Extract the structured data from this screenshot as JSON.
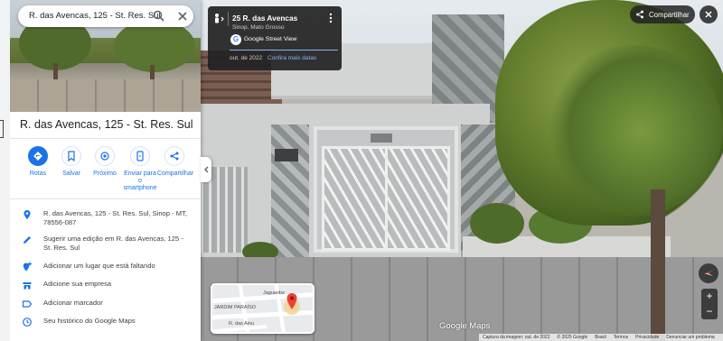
{
  "search": {
    "value": "R. das Avencas, 125 - St. Res. Sul"
  },
  "place": {
    "title": "R. das Avencas, 125 - St. Res. Sul"
  },
  "actions": [
    {
      "label": "Rotas",
      "icon": "directions-icon"
    },
    {
      "label": "Salvar",
      "icon": "bookmark-icon"
    },
    {
      "label": "Próximo",
      "icon": "nearby-icon"
    },
    {
      "label": "Enviar para o smartphone",
      "icon": "send-to-phone-icon"
    },
    {
      "label": "Compartilhar",
      "icon": "share-icon"
    }
  ],
  "info": [
    {
      "text": "R. das Avencas, 125 - St. Res. Sul, Sinop - MT, 78556-087",
      "icon": "location-pin-icon"
    },
    {
      "text": "Sugerir uma edição em R. das Avencas, 125 - St. Res. Sul",
      "icon": "edit-pencil-icon"
    },
    {
      "text": "Adicionar um lugar que está faltando",
      "icon": "add-place-icon"
    },
    {
      "text": "Adicione sua empresa",
      "icon": "business-icon"
    },
    {
      "text": "Adicionar marcador",
      "icon": "label-icon"
    },
    {
      "text": "Seu histórico do Google Maps",
      "icon": "history-icon"
    }
  ],
  "streetview": {
    "title": "25 R. das Avencas",
    "subtitle": "Sinop, Mato Grosso",
    "service": "Google Street View",
    "date": "out. de 2022",
    "more_dates": "Confira mais datas"
  },
  "top": {
    "share_label": "Compartilhar"
  },
  "minimap": {
    "labels": [
      "Jaguaribe",
      "JARDIM PARAÍSO",
      "R. das Ainu"
    ]
  },
  "watermark": "Google Maps",
  "footer": [
    "Captura da imagem: out. de 2022",
    "© 2025 Google",
    "Brasil",
    "Termos",
    "Privacidade",
    "Denunciar um problema"
  ],
  "colors": {
    "accent": "#1a73e8",
    "card_bg": "#222222",
    "pin": "#ea4335"
  }
}
